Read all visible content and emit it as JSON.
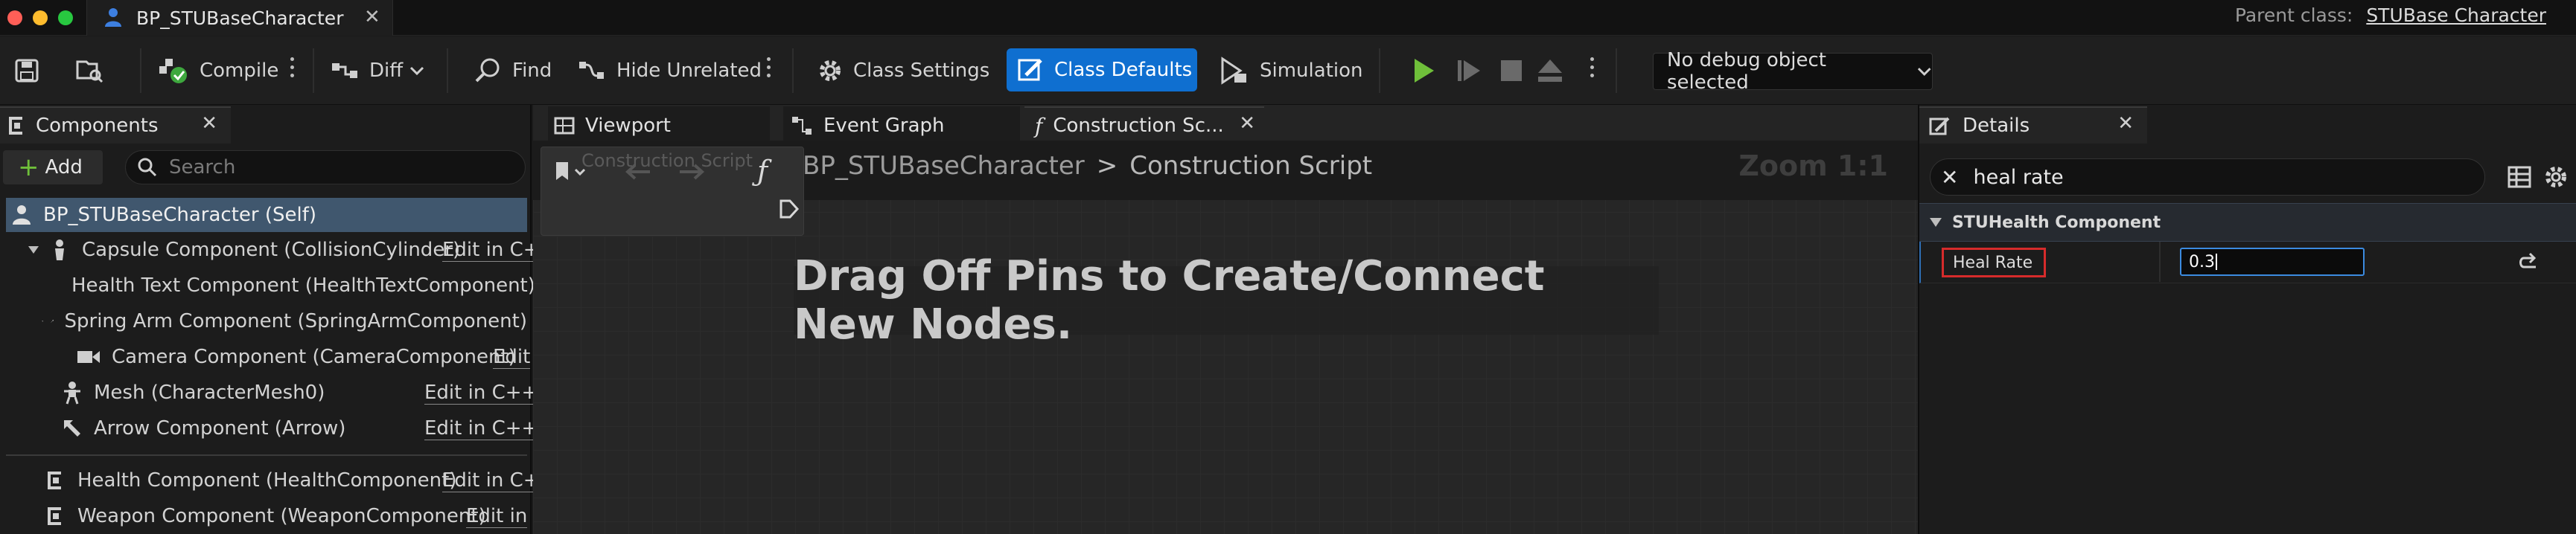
{
  "window": {
    "tab_title": "BP_STUBaseCharacter",
    "parent_class_label": "Parent class:",
    "parent_class_value": "STUBase Character"
  },
  "toolbar": {
    "compile": "Compile",
    "diff": "Diff",
    "find": "Find",
    "hide_unrelated": "Hide Unrelated",
    "class_settings": "Class Settings",
    "class_defaults": "Class Defaults",
    "simulation": "Simulation",
    "debug_object": "No debug object selected"
  },
  "components_panel": {
    "title": "Components",
    "add_label": "Add",
    "search_placeholder": "Search",
    "items": [
      {
        "label": "BP_STUBaseCharacter (Self)",
        "edit": ""
      },
      {
        "label": "Capsule Component (CollisionCylinder)",
        "edit": "Edit in C+"
      },
      {
        "label": "Health Text Component (HealthTextComponent)",
        "edit": ""
      },
      {
        "label": "Spring Arm Component (SpringArmComponent)",
        "edit": ""
      },
      {
        "label": "Camera Component (CameraComponent)",
        "edit": "Edit"
      },
      {
        "label": "Mesh (CharacterMesh0)",
        "edit": "Edit in C++"
      },
      {
        "label": "Arrow Component (Arrow)",
        "edit": "Edit in C++"
      },
      {
        "label": "Health Component (HealthComponent)",
        "edit": "Edit in C+"
      },
      {
        "label": "Weapon Component (WeaponComponent)",
        "edit": "Edit in"
      }
    ]
  },
  "graph": {
    "tabs": [
      {
        "label": "Viewport"
      },
      {
        "label": "Event Graph"
      },
      {
        "label": "Construction Sc..."
      }
    ],
    "mini_title": "Construction Script",
    "breadcrumb_root": "BP_STUBaseCharacter",
    "breadcrumb_sep": ">",
    "breadcrumb_leaf": "Construction Script",
    "zoom": "Zoom 1:1",
    "hint": "Drag Off Pins to Create/Connect New Nodes."
  },
  "details_panel": {
    "title": "Details",
    "search_value": "heal rate",
    "category": "STUHealth Component",
    "property_name": "Heal Rate",
    "property_value": "0.3"
  },
  "colors": {
    "accent_blue": "#0f6fd0",
    "highlight_red": "#d62b2b",
    "play_green": "#6fbf3a"
  }
}
